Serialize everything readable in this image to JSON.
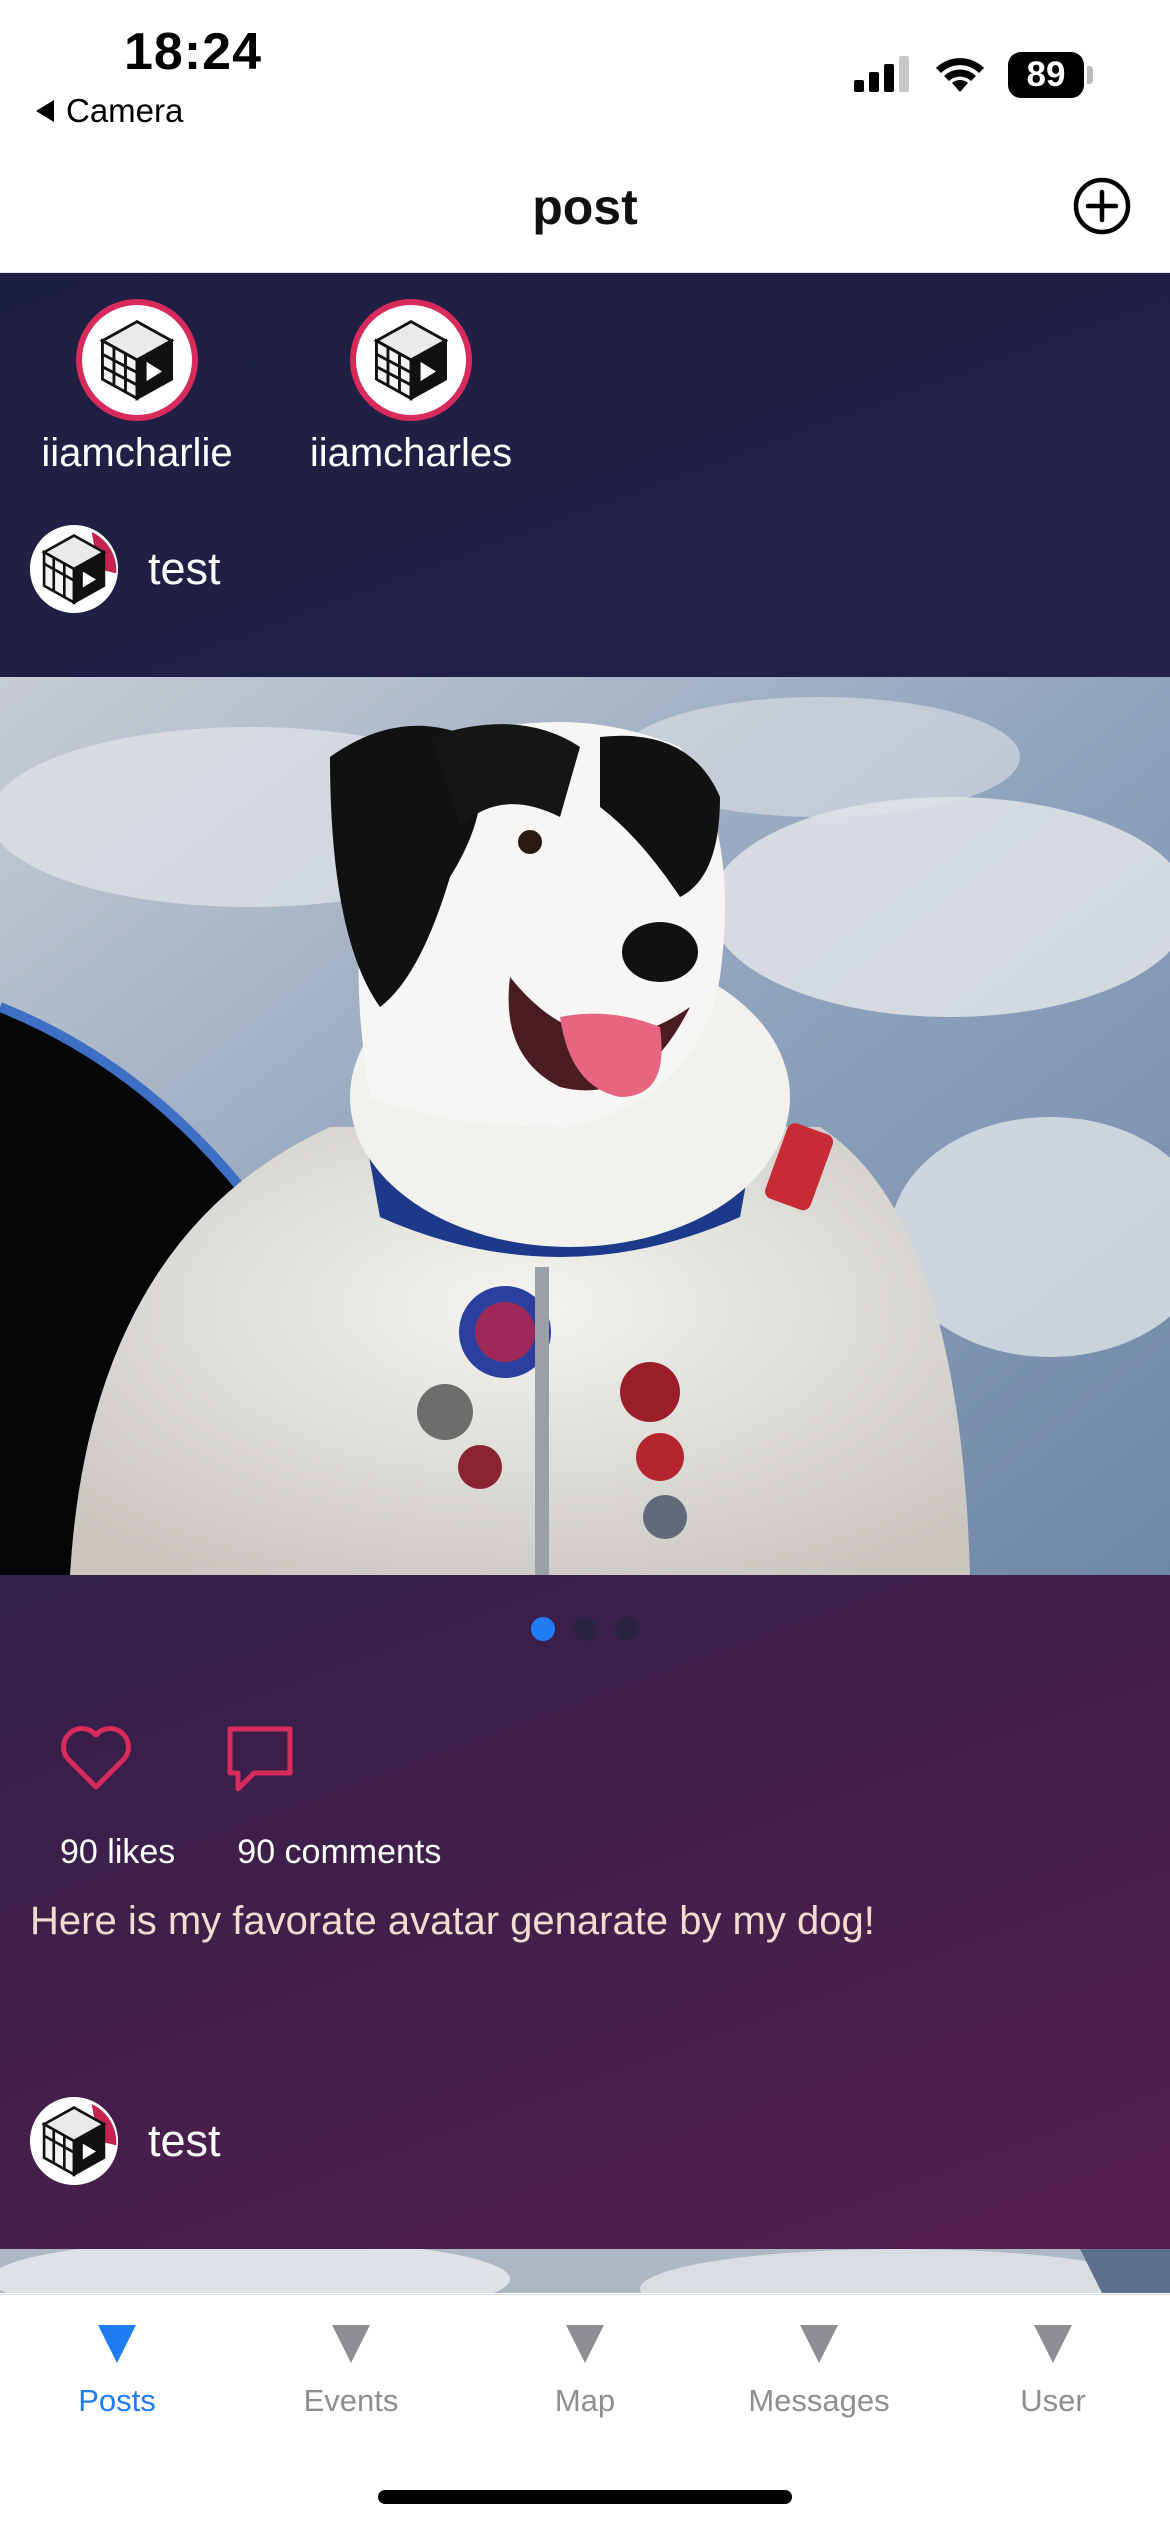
{
  "status_bar": {
    "time": "18:24",
    "back_label": "Camera",
    "battery": "89",
    "icons": [
      "signal-icon",
      "wifi-icon",
      "battery-icon"
    ]
  },
  "header": {
    "title": "post",
    "add_icon": "plus-circle-icon"
  },
  "stories": [
    {
      "name": "iiamcharlie"
    },
    {
      "name": "iiamcharles"
    }
  ],
  "posts": [
    {
      "username": "test",
      "image_description_icon": "post-photo",
      "likes": "90 likes",
      "comments": "90 comments",
      "caption": "Here is my favorate avatar genarate by my dog!",
      "carousel": {
        "count": 3,
        "active_index": 0
      }
    },
    {
      "username": "test"
    }
  ],
  "tabbar": {
    "tabs": [
      {
        "label": "Posts",
        "active": true
      },
      {
        "label": "Events",
        "active": false
      },
      {
        "label": "Map",
        "active": false
      },
      {
        "label": "Messages",
        "active": false
      },
      {
        "label": "User",
        "active": false
      }
    ]
  },
  "colors": {
    "accent": "#1f7cf5",
    "heart": "#d72b5c",
    "feed_gradient_start": "#1d1f41",
    "feed_gradient_end": "#561f4d"
  }
}
